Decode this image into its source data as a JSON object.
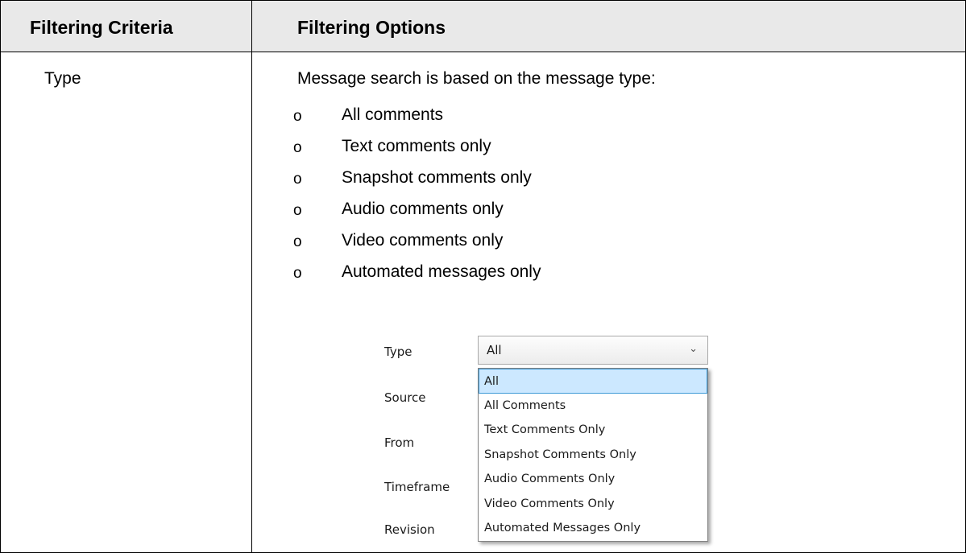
{
  "table": {
    "headers": [
      "Filtering Criteria",
      "Filtering Options"
    ],
    "criterion": "Type",
    "description": "Message search is based on the message type:",
    "bullet_symbol": "o",
    "options": [
      "All comments",
      "Text comments only",
      "Snapshot comments only",
      "Audio comments only",
      "Video comments only",
      "Automated messages only"
    ]
  },
  "filter_panel": {
    "labels": [
      "Type",
      "Source",
      "From",
      "Timeframe",
      "Revision"
    ],
    "type_select": {
      "selected_value": "All",
      "open": true,
      "options": [
        "All",
        "All Comments",
        "Text Comments Only",
        "Snapshot Comments Only",
        "Audio Comments Only",
        "Video Comments Only",
        "Automated Messages Only"
      ],
      "highlighted_option": "All"
    },
    "icons": {
      "dropdown_arrow": "chevron-down-icon"
    },
    "colors": {
      "highlight_bg": "#cce8ff",
      "highlight_border": "#3d9ad6"
    }
  }
}
